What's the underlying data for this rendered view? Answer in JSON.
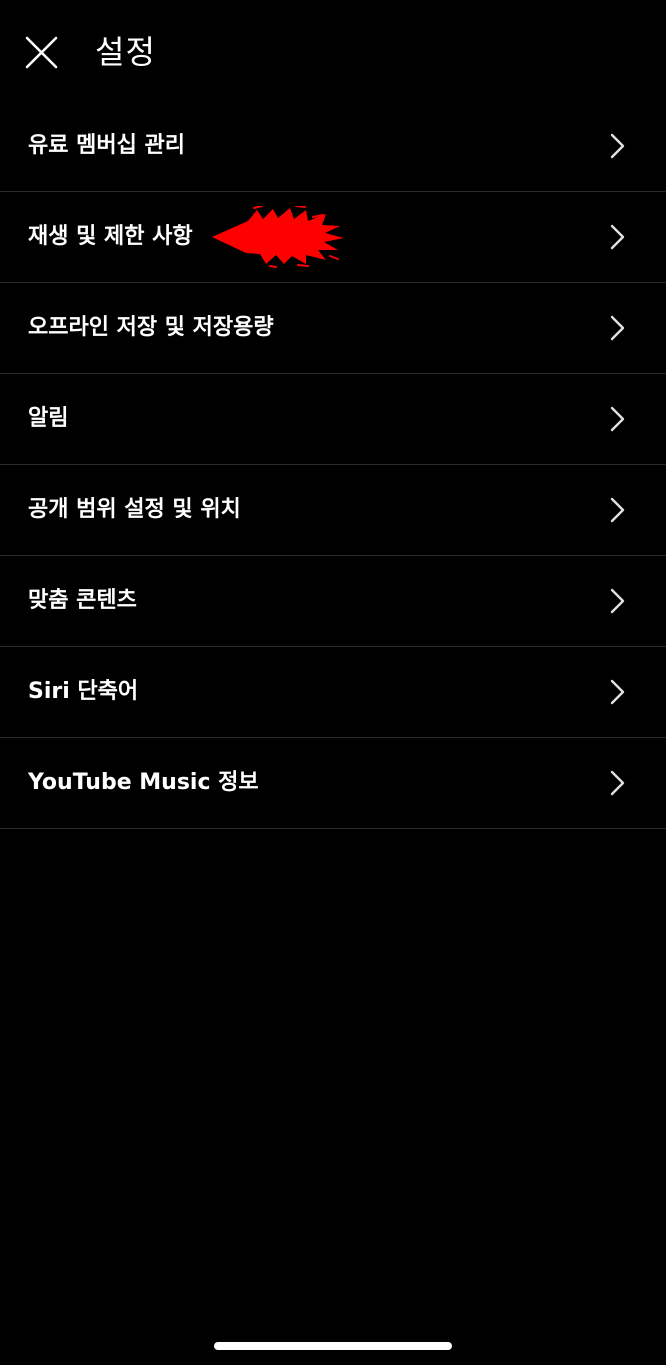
{
  "header": {
    "title": "설정",
    "close_icon": "close-icon"
  },
  "menu": {
    "items": [
      {
        "label": "유료 멤버십 관리",
        "icon": "chevron-right-icon"
      },
      {
        "label": "재생 및 제한 사항",
        "icon": "chevron-right-icon"
      },
      {
        "label": "오프라인 저장 및 저장용량",
        "icon": "chevron-right-icon"
      },
      {
        "label": "알림",
        "icon": "chevron-right-icon"
      },
      {
        "label": "공개 범위 설정 및 위치",
        "icon": "chevron-right-icon"
      },
      {
        "label": "맞춤 콘텐츠",
        "icon": "chevron-right-icon"
      },
      {
        "label": "Siri 단축어",
        "icon": "chevron-right-icon"
      },
      {
        "label": "YouTube Music 정보",
        "icon": "chevron-right-icon"
      }
    ]
  },
  "annotation": {
    "icon": "red-arrow-icon",
    "color": "#ff0000"
  },
  "colors": {
    "background": "#000000",
    "text": "#ffffff",
    "divider": "#2b2b2b",
    "chevron": "#e0e0e0"
  }
}
